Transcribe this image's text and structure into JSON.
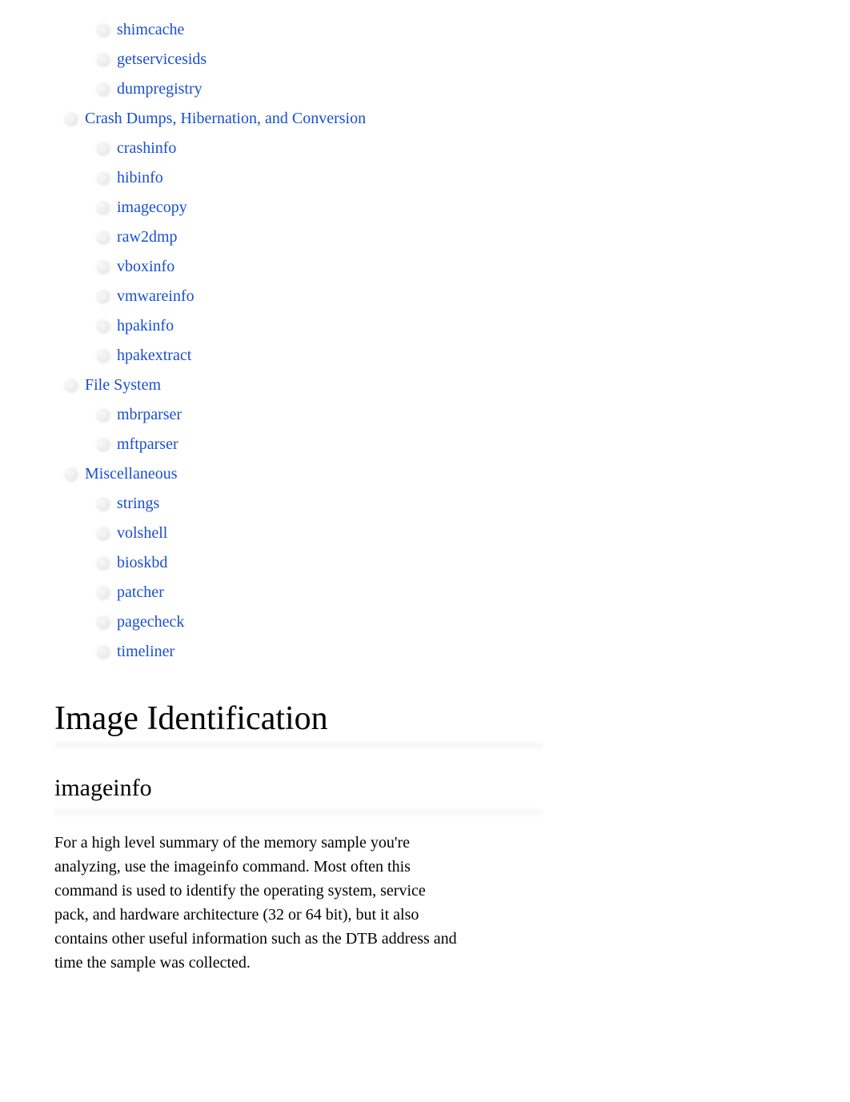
{
  "toc": {
    "orphan_items": [
      "shimcache",
      "getservicesids",
      "dumpregistry"
    ],
    "sections": [
      {
        "label": "Crash Dumps, Hibernation, and Conversion",
        "items": [
          "crashinfo",
          "hibinfo",
          "imagecopy",
          "raw2dmp",
          "vboxinfo",
          "vmwareinfo",
          "hpakinfo",
          "hpakextract"
        ]
      },
      {
        "label": "File System",
        "items": [
          "mbrparser",
          "mftparser"
        ]
      },
      {
        "label": "Miscellaneous",
        "items": [
          "strings",
          "volshell",
          "bioskbd",
          "patcher",
          "pagecheck",
          "timeliner"
        ]
      }
    ]
  },
  "heading1": "Image Identification",
  "heading2": "imageinfo",
  "paragraph": "For a high level summary of the memory sample you're analyzing, use the imageinfo command. Most often this command is used to identify the operating system, service pack, and hardware architecture (32 or 64 bit), but it also contains other useful information such as the DTB address and time the sample was collected."
}
